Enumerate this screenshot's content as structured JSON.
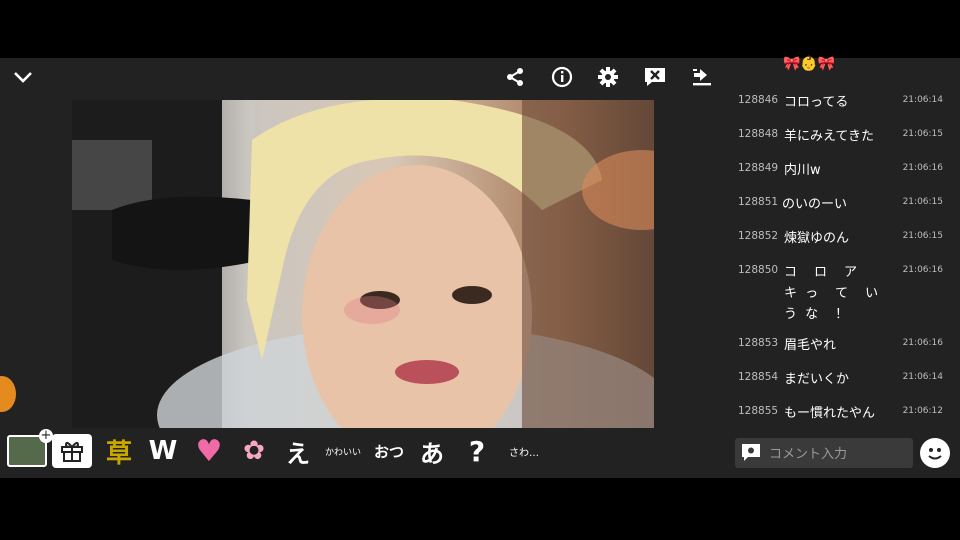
{
  "header": {
    "collapse_icon": "chevron-down-icon",
    "share_icon": "share-icon",
    "info_icon": "info-icon",
    "settings_icon": "gear-icon",
    "close_comments_icon": "comment-off-icon",
    "download_icon": "download-icon",
    "ribbon_emoji": "🎀👶🎀"
  },
  "chat": {
    "messages": [
      {
        "num": "128846",
        "text": "コロってる",
        "time": "21:06:14"
      },
      {
        "num": "128848",
        "text": "羊にみえてきた",
        "time": "21:06:15"
      },
      {
        "num": "128849",
        "text": "内川w",
        "time": "21:06:16"
      },
      {
        "num": "128851",
        "text": "のいのーい",
        "time": "21:06:15"
      },
      {
        "num": "128852",
        "text": "煉獄ゆのん",
        "time": "21:06:15"
      },
      {
        "num": "128850",
        "text": "コ　ロ　ア　キ っ　て　い　う な　！",
        "time": "21:06:16"
      },
      {
        "num": "128853",
        "text": "眉毛やれ",
        "time": "21:06:16"
      },
      {
        "num": "128854",
        "text": "まだいくか",
        "time": "21:06:14"
      },
      {
        "num": "128855",
        "text": "もー慣れたやん",
        "time": "21:06:12"
      }
    ]
  },
  "reactions": {
    "kusa": "草",
    "w": "W",
    "heart": "♥",
    "sakura": "✿",
    "e": "え",
    "kawaii": "かわいい",
    "otsu": "おつ",
    "a": "あ",
    "question": "?",
    "sawa": "さわ…"
  },
  "comment": {
    "placeholder": "コメント入力"
  },
  "colors": {
    "kusa": "#c8a800",
    "heart": "#f06aa8",
    "sakura": "#f7a6c4"
  }
}
